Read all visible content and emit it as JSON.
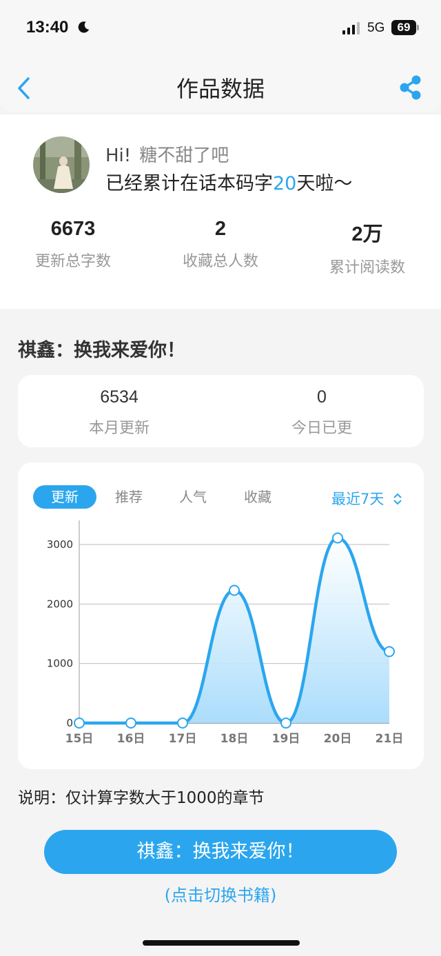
{
  "status_bar": {
    "time": "13:40",
    "network": "5G",
    "battery": "69"
  },
  "nav": {
    "title": "作品数据"
  },
  "profile": {
    "greeting": "Hi!",
    "nickname": "糖不甜了吧",
    "days_prefix": "已经累计在话本码字",
    "days_value": "20",
    "days_suffix": "天啦～"
  },
  "stats": [
    {
      "value": "6673",
      "label": "更新总字数"
    },
    {
      "value": "2",
      "label": "收藏总人数"
    },
    {
      "value": "2万",
      "label": "累计阅读数"
    }
  ],
  "book_title": "祺鑫：换我来爱你！",
  "monthly": [
    {
      "value": "6534",
      "label": "本月更新"
    },
    {
      "value": "0",
      "label": "今日已更"
    }
  ],
  "tabs": [
    "更新",
    "推荐",
    "人气",
    "收藏"
  ],
  "range_label": "最近7天",
  "chart_data": {
    "type": "area",
    "categories": [
      "15日",
      "16日",
      "17日",
      "18日",
      "19日",
      "20日",
      "21日"
    ],
    "values": [
      0,
      0,
      0,
      2230,
      0,
      3110,
      1200
    ],
    "y_ticks": [
      "0",
      "1000",
      "2000",
      "3000"
    ],
    "ylim": [
      0,
      3200
    ],
    "grid": true,
    "color": "#2ba6ee"
  },
  "note": "说明：仅计算字数大于1000的章节",
  "switch": {
    "button": "祺鑫：换我来爱你！",
    "hint": "(点击切换书籍)"
  }
}
